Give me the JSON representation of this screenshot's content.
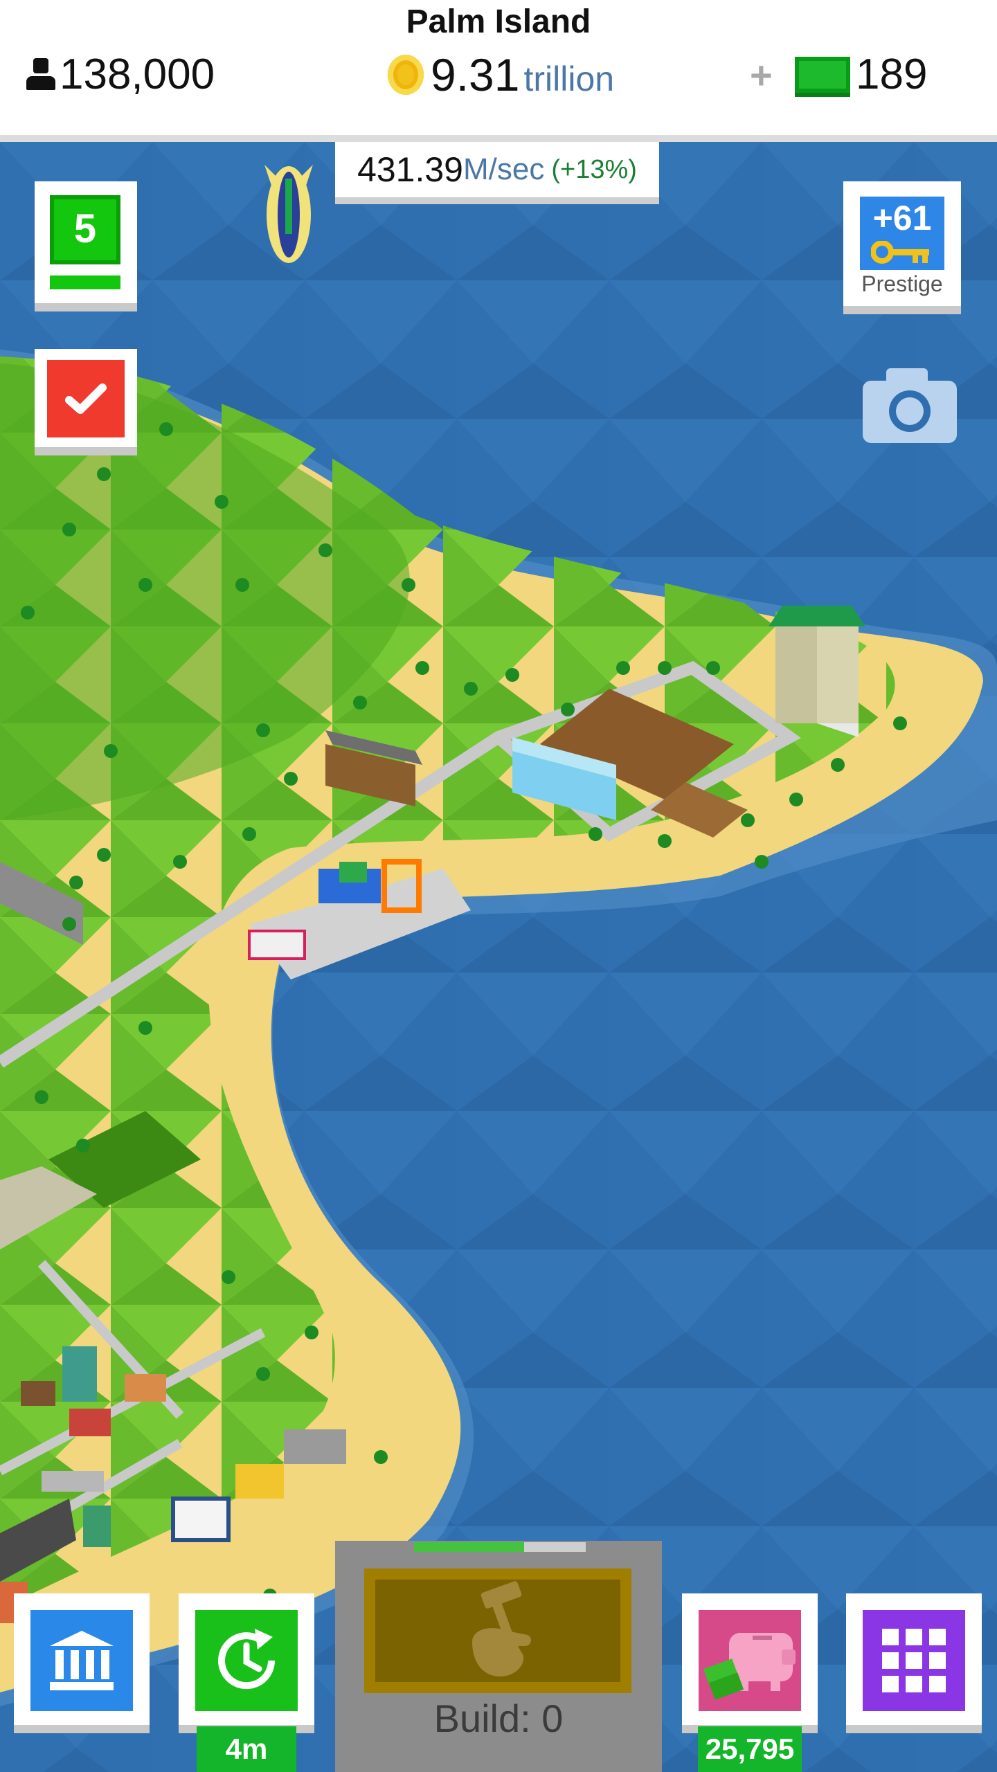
{
  "header": {
    "title": "Palm Island",
    "population": "138,000",
    "coins_value": "9.31",
    "coins_unit": "trillion",
    "plus_label": "+",
    "cash_value": "189"
  },
  "income": {
    "amount": "431.39",
    "unit": "M/sec",
    "bonus": "(+13%)"
  },
  "side": {
    "level": "5",
    "prestige_count": "+61",
    "prestige_label": "Prestige"
  },
  "bottom": {
    "boost_timer": "4m",
    "build_label": "Build: 0",
    "build_progress": 0.64,
    "piggy_value": "25,795"
  },
  "colors": {
    "ocean": "#2f6fb0",
    "grass": "#6cc02e",
    "sand": "#f2d77e",
    "accent_green": "#13c70e",
    "bank_blue": "#2a88e8",
    "menu_purple": "#8a36e4",
    "piggy_pink": "#d64a8a"
  },
  "icons": [
    "person-icon",
    "coin-icon",
    "cash-icon",
    "blimp-icon",
    "check-icon",
    "key-icon",
    "camera-icon",
    "bank-icon",
    "clock-refresh-icon",
    "hammer-hand-icon",
    "piggy-bank-icon",
    "grid-menu-icon"
  ]
}
